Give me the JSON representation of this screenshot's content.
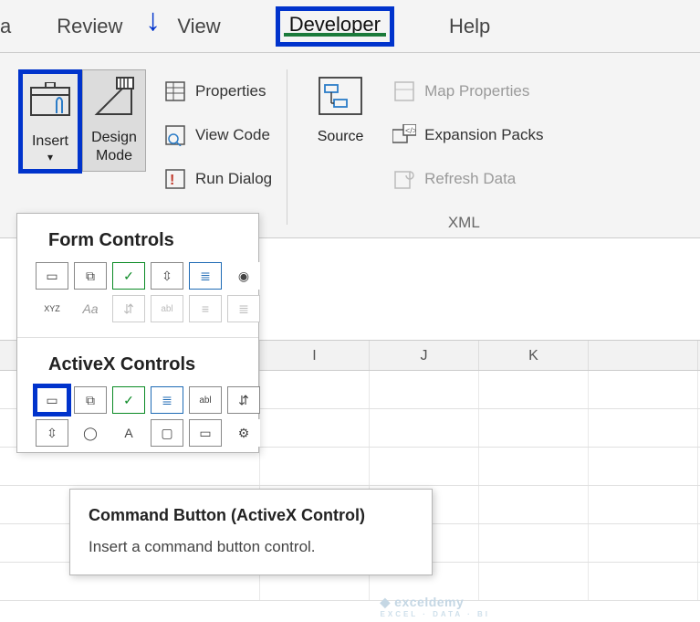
{
  "tabs": {
    "partial": "a",
    "review": "Review",
    "view": "View",
    "developer": "Developer",
    "help": "Help"
  },
  "ribbon": {
    "insert": {
      "label": "Insert"
    },
    "design": {
      "label": "Design\nMode"
    },
    "properties": "Properties",
    "view_code": "View Code",
    "run_dialog": "Run Dialog",
    "source": "Source",
    "map_properties": "Map Properties",
    "expansion_packs": "Expansion Packs",
    "refresh_data": "Refresh Data",
    "xml_group": "XML"
  },
  "dropdown": {
    "form_title": "Form Controls",
    "activex_title": "ActiveX Controls",
    "items_form_r1": {
      "button": "▭",
      "combo": "⧉",
      "check": "✓",
      "spin": "⇳",
      "list": "≣",
      "option": "◉"
    },
    "items_form_r2": {
      "group": "XYZ",
      "label": "Aa",
      "scroll": "⇵",
      "text": "abl",
      "more1": "≡",
      "more2": "≣"
    },
    "items_ax_r1": {
      "cmd": "▭",
      "combo": "⧉",
      "check": "✓",
      "list": "≣",
      "text": "abl",
      "scroll": "⇵"
    },
    "items_ax_r2": {
      "spin": "⇳",
      "option": "◯",
      "label": "A",
      "image": "▢",
      "toggle": "▭",
      "more": "⚙"
    }
  },
  "tooltip": {
    "title": "Command Button (ActiveX Control)",
    "body": "Insert a command button control."
  },
  "sheet": {
    "cols": [
      "",
      "I",
      "J",
      "K",
      ""
    ]
  },
  "watermark": {
    "brand": "exceldemy",
    "sub": "EXCEL · DATA · BI"
  }
}
